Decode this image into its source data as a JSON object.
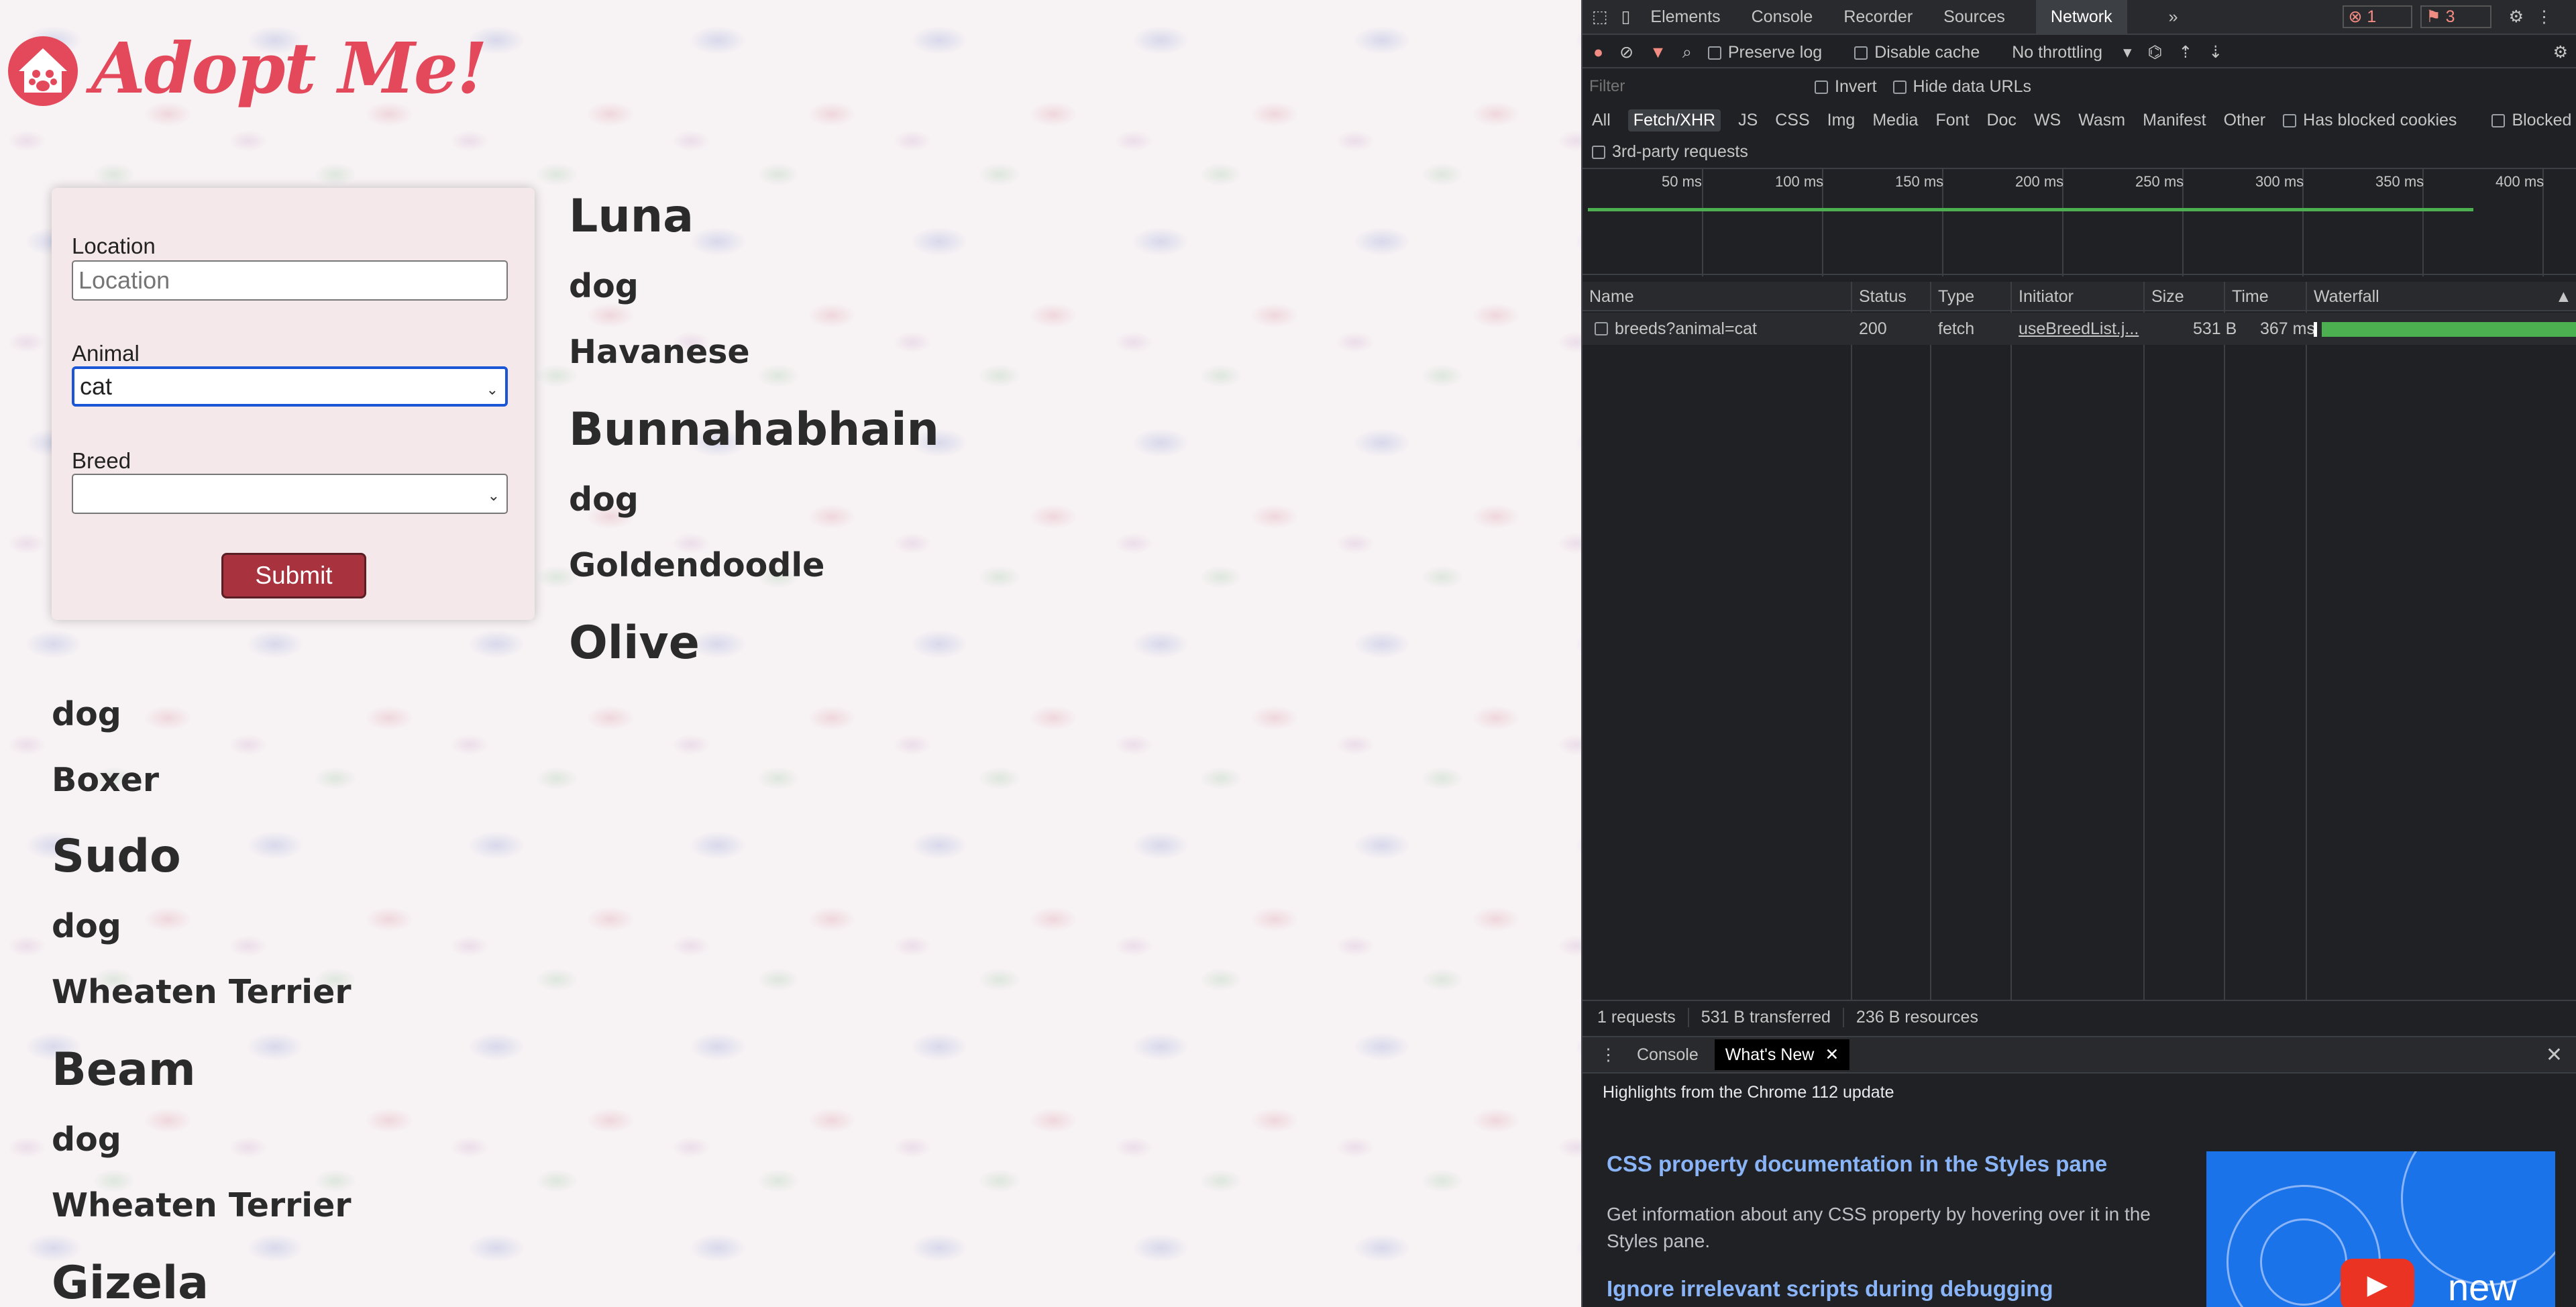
{
  "app": {
    "logo_text": "Adopt Me!"
  },
  "form": {
    "location_label": "Location",
    "location_value": "",
    "location_placeholder": "Location",
    "animal_label": "Animal",
    "animal_value": "cat",
    "breed_label": "Breed",
    "breed_value": "",
    "submit_label": "Submit"
  },
  "pets": [
    {
      "name": "Luna",
      "animal": "dog",
      "breed": "Havanese"
    },
    {
      "name": "Bunnahabhain",
      "animal": "dog",
      "breed": "Goldendoodle"
    },
    {
      "name": "Olive",
      "animal": "dog",
      "breed": "Boxer"
    },
    {
      "name": "Sudo",
      "animal": "dog",
      "breed": "Wheaten Terrier"
    },
    {
      "name": "Beam",
      "animal": "dog",
      "breed": "Wheaten Terrier"
    },
    {
      "name": "Gizela",
      "animal": "",
      "breed": ""
    }
  ],
  "devtools": {
    "tabs": [
      "Elements",
      "Console",
      "Recorder",
      "Sources",
      "Network"
    ],
    "active_tab": "Network",
    "more": "»",
    "errors": "1",
    "issues": "3",
    "toolbar": {
      "preserve_log": "Preserve log",
      "disable_cache": "Disable cache",
      "throttling": "No throttling"
    },
    "filter_placeholder": "Filter",
    "invert": "Invert",
    "hide_data_urls": "Hide data URLs",
    "types": [
      "All",
      "Fetch/XHR",
      "JS",
      "CSS",
      "Img",
      "Media",
      "Font",
      "Doc",
      "WS",
      "Wasm",
      "Manifest",
      "Other"
    ],
    "active_type": "Fetch/XHR",
    "has_blocked_cookies": "Has blocked cookies",
    "blocked_requests": "Blocked Requests",
    "third_party": "3rd-party requests",
    "timeline_ticks": [
      "50 ms",
      "100 ms",
      "150 ms",
      "200 ms",
      "250 ms",
      "300 ms",
      "350 ms",
      "400 ms"
    ],
    "columns": {
      "name": "Name",
      "status": "Status",
      "type": "Type",
      "initiator": "Initiator",
      "size": "Size",
      "time": "Time",
      "waterfall": "Waterfall"
    },
    "request": {
      "name": "breeds?animal=cat",
      "status": "200",
      "type": "fetch",
      "initiator": "useBreedList.j...",
      "size": "531 B",
      "time": "367 ms"
    },
    "summary": {
      "requests": "1 requests",
      "transferred": "531 B transferred",
      "resources": "236 B resources"
    },
    "drawer": {
      "console_tab": "Console",
      "whats_new_tab": "What's New",
      "highlights": "Highlights from the Chrome 112 update",
      "item1_title": "CSS property documentation in the Styles pane",
      "item1_desc": "Get information about any CSS property by hovering over it in the Styles pane.",
      "item2_title": "Ignore irrelevant scripts during debugging",
      "video_label": "new"
    }
  },
  "colors": {
    "brand": "#e3495a",
    "submit": "#a8323d",
    "devtools_bg": "#202124",
    "link": "#8ab4f8",
    "waterfall": "#4caf50"
  }
}
